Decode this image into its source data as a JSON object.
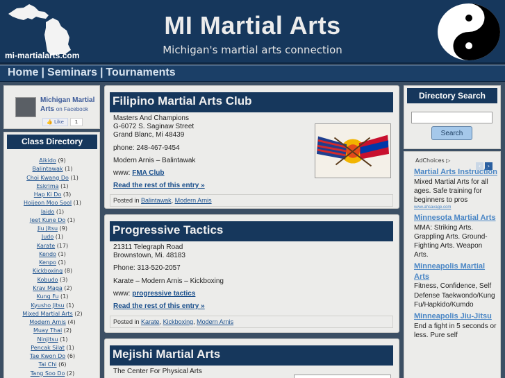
{
  "header": {
    "title": "MI Martial Arts",
    "tagline": "Michigan's martial arts connection",
    "domain": "mi-martialarts.com"
  },
  "nav": {
    "items": [
      "Home",
      "Seminars",
      "Tournaments"
    ]
  },
  "facebook": {
    "page_name": "Michigan Martial Arts",
    "suffix": "on Facebook",
    "like_label": "Like",
    "like_count": "1"
  },
  "directory": {
    "heading": "Class Directory",
    "items": [
      {
        "name": "Aikido",
        "count": "(9)"
      },
      {
        "name": "Balintawak",
        "count": "(1)"
      },
      {
        "name": "Choi Kwang Do",
        "count": "(1)"
      },
      {
        "name": "Eskrima",
        "count": "(1)"
      },
      {
        "name": "Hap Ki Do",
        "count": "(3)"
      },
      {
        "name": "Hoijeon Moo Sool",
        "count": "(1)"
      },
      {
        "name": "Iaido",
        "count": "(1)"
      },
      {
        "name": "Jeet Kune Do",
        "count": "(1)"
      },
      {
        "name": "Jiu Jitsu",
        "count": "(9)"
      },
      {
        "name": "Judo",
        "count": "(1)"
      },
      {
        "name": "Karate",
        "count": "(17)"
      },
      {
        "name": "Kendo",
        "count": "(1)"
      },
      {
        "name": "Kenpo",
        "count": "(1)"
      },
      {
        "name": "Kickboxing",
        "count": "(8)"
      },
      {
        "name": "Kobudo",
        "count": "(3)"
      },
      {
        "name": "Krav Maga",
        "count": "(2)"
      },
      {
        "name": "Kung Fu",
        "count": "(1)"
      },
      {
        "name": "Kyusho Jitsu",
        "count": "(1)"
      },
      {
        "name": "Mixed Martial Arts",
        "count": "(2)"
      },
      {
        "name": "Modern Arnis",
        "count": "(4)"
      },
      {
        "name": "Muay Thai",
        "count": "(2)"
      },
      {
        "name": "Ninjitsu",
        "count": "(1)"
      },
      {
        "name": "Pencak Silat",
        "count": "(1)"
      },
      {
        "name": "Tae Kwon Do",
        "count": "(6)"
      },
      {
        "name": "Tai Chi",
        "count": "(6)"
      },
      {
        "name": "Tang Soo Do",
        "count": "(2)"
      }
    ]
  },
  "posts": [
    {
      "title": "Filipino Martial Arts Club",
      "address": [
        "Masters And Champions",
        "G-6072 S. Saginaw Street",
        "Grand Blanc, Mi 48439"
      ],
      "phone": "phone: 248-467-9454",
      "styles": "Modern Arnis – Balintawak",
      "www_label": "www:",
      "www_link": "FMA Club",
      "more": "Read the rest of this entry »",
      "posted_in": "Posted in",
      "categories": [
        "Balintawak",
        "Modern Arnis"
      ]
    },
    {
      "title": "Progressive Tactics",
      "address": [
        "21311 Telegraph Road",
        "Brownstown, Mi. 48183"
      ],
      "phone": "Phone: 313-520-2057",
      "styles": "Karate – Modern Arnis – Kickboxing",
      "www_label": "www:",
      "www_link": "progressive tactics",
      "more": "Read the rest of this entry »",
      "posted_in": "Posted in",
      "categories": [
        "Karate",
        "Kickboxing",
        "Modern Arnis"
      ]
    },
    {
      "title": "Mejishi Martial Arts",
      "address": [
        "The Center For Physical Arts"
      ]
    }
  ],
  "search": {
    "heading": "Directory Search",
    "value": "",
    "button": "Search"
  },
  "ads": {
    "adchoices": "AdChoices",
    "prev": "‹",
    "next": "›",
    "items": [
      {
        "title": "Martial Arts Instruction",
        "text": "Mixed Martial Arts for all ages. Safe training for beginners to pros",
        "url": "www.ahsavage.com"
      },
      {
        "title": "Minnesota Martial Arts",
        "text": "MMA: Striking Arts. Grappling Arts. Ground-Fighting Arts. Weapon Arts.",
        "url": ""
      },
      {
        "title": "Minneapolis Martial Arts",
        "text": "Fitness, Confidence, Self Defense Taekwondo/Kung Fu/Hapkido/Kumdo",
        "url": ""
      },
      {
        "title": "Minneapolis Jiu-Jitsu",
        "text": "End a fight in 5 seconds or less. Pure self",
        "url": ""
      }
    ]
  }
}
